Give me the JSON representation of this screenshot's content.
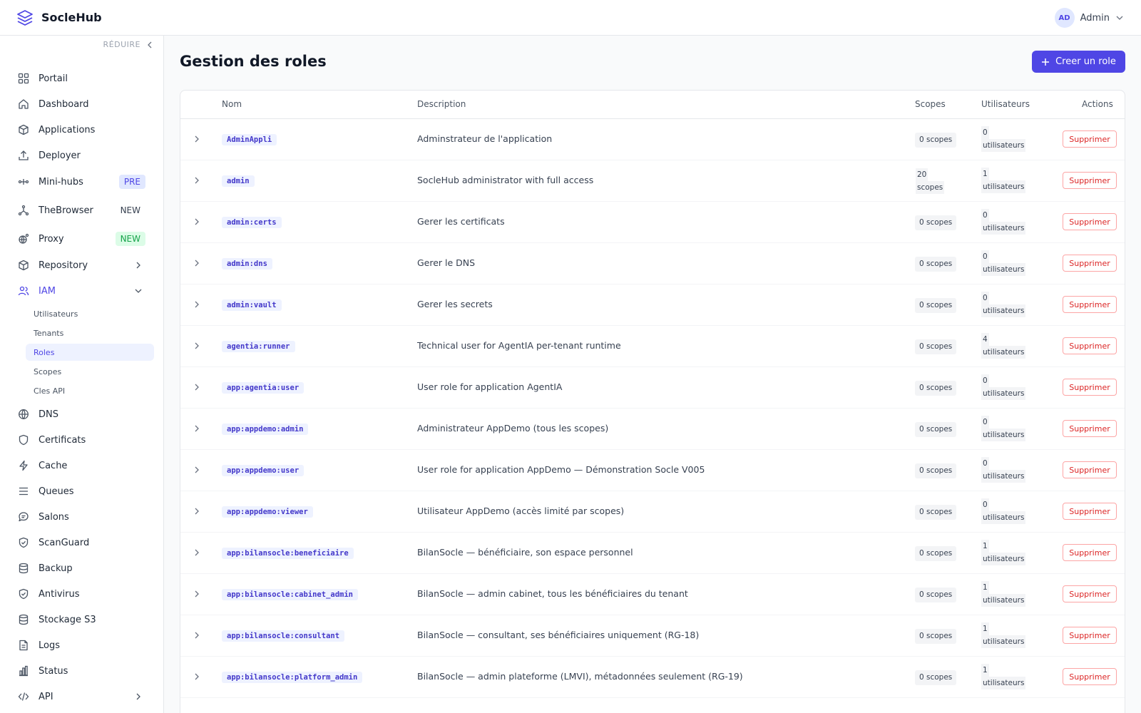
{
  "app": {
    "name": "SocleHub"
  },
  "user": {
    "initials": "AD",
    "name": "Admin"
  },
  "sidebar": {
    "collapse_label": "RÉDUIRE",
    "items": [
      {
        "label": "Portail",
        "icon": "grid-icon"
      },
      {
        "label": "Dashboard",
        "icon": "home-icon"
      },
      {
        "label": "Applications",
        "icon": "box-icon"
      },
      {
        "label": "Deployer",
        "icon": "upload-icon"
      },
      {
        "label": "Mini-hubs",
        "icon": "hub-icon",
        "badge": "PRE"
      },
      {
        "label": "TheBrowser",
        "icon": "network-icon",
        "badge": "NEW"
      },
      {
        "label": "Proxy",
        "icon": "globe-gear-icon",
        "badge": "NEW"
      },
      {
        "label": "Repository",
        "icon": "package-icon"
      },
      {
        "label": "IAM",
        "icon": "users-icon"
      },
      {
        "label": "DNS",
        "icon": "globe-icon"
      },
      {
        "label": "Certificats",
        "icon": "shield-icon"
      },
      {
        "label": "Cache",
        "icon": "bolt-icon"
      },
      {
        "label": "Queues",
        "icon": "list-icon"
      },
      {
        "label": "Salons",
        "icon": "chat-icon"
      },
      {
        "label": "ScanGuard",
        "icon": "shield-check-icon"
      },
      {
        "label": "Backup",
        "icon": "database-icon"
      },
      {
        "label": "Antivirus",
        "icon": "shield-check-icon"
      },
      {
        "label": "Stockage S3",
        "icon": "database-icon"
      },
      {
        "label": "Logs",
        "icon": "file-icon"
      },
      {
        "label": "Status",
        "icon": "bar-chart-icon"
      },
      {
        "label": "API",
        "icon": "code-icon"
      }
    ],
    "iam_sub": [
      "Utilisateurs",
      "Tenants",
      "Roles",
      "Scopes",
      "Cles API"
    ],
    "active_sub": "Roles"
  },
  "page": {
    "title": "Gestion des roles",
    "create_label": "Creer un role"
  },
  "table": {
    "headers": {
      "name": "Nom",
      "description": "Description",
      "scopes": "Scopes",
      "users": "Utilisateurs",
      "actions": "Actions"
    },
    "delete_label": "Supprimer",
    "rows": [
      {
        "name": "AdminAppli",
        "description": "Adminstrateur de l'application",
        "scopes": "0 scopes",
        "users_count": "0",
        "users_unit": "utilisateurs"
      },
      {
        "name": "admin",
        "description": "SocleHub administrator with full access",
        "scopes_count": "20",
        "scopes_unit": "scopes",
        "users_count": "1",
        "users_unit": "utilisateurs"
      },
      {
        "name": "admin:certs",
        "description": "Gerer les certificats",
        "scopes": "0 scopes",
        "users_count": "0",
        "users_unit": "utilisateurs"
      },
      {
        "name": "admin:dns",
        "description": "Gerer le DNS",
        "scopes": "0 scopes",
        "users_count": "0",
        "users_unit": "utilisateurs"
      },
      {
        "name": "admin:vault",
        "description": "Gerer les secrets",
        "scopes": "0 scopes",
        "users_count": "0",
        "users_unit": "utilisateurs"
      },
      {
        "name": "agentia:runner",
        "description": "Technical user for AgentIA per-tenant runtime",
        "scopes": "0 scopes",
        "users_count": "4",
        "users_unit": "utilisateurs"
      },
      {
        "name": "app:agentia:user",
        "description": "User role for application AgentIA",
        "scopes": "0 scopes",
        "users_count": "0",
        "users_unit": "utilisateurs"
      },
      {
        "name": "app:appdemo:admin",
        "description": "Administrateur AppDemo (tous les scopes)",
        "scopes": "0 scopes",
        "users_count": "0",
        "users_unit": "utilisateurs"
      },
      {
        "name": "app:appdemo:user",
        "description": "User role for application AppDemo — Démonstration Socle V005",
        "scopes": "0 scopes",
        "users_count": "0",
        "users_unit": "utilisateurs"
      },
      {
        "name": "app:appdemo:viewer",
        "description": "Utilisateur AppDemo (accès limité par scopes)",
        "scopes": "0 scopes",
        "users_count": "0",
        "users_unit": "utilisateurs"
      },
      {
        "name": "app:bilansocle:beneficiaire",
        "description": "BilanSocle — bénéficiaire, son espace personnel",
        "scopes": "0 scopes",
        "users_count": "1",
        "users_unit": "utilisateurs"
      },
      {
        "name": "app:bilansocle:cabinet_admin",
        "description": "BilanSocle — admin cabinet, tous les bénéficiaires du tenant",
        "scopes": "0 scopes",
        "users_count": "1",
        "users_unit": "utilisateurs"
      },
      {
        "name": "app:bilansocle:consultant",
        "description": "BilanSocle — consultant, ses bénéficiaires uniquement (RG-18)",
        "scopes": "0 scopes",
        "users_count": "1",
        "users_unit": "utilisateurs"
      },
      {
        "name": "app:bilansocle:platform_admin",
        "description": "BilanSocle — admin plateforme (LMVI), métadonnées seulement (RG-19)",
        "scopes": "0 scopes",
        "users_count": "1",
        "users_unit": "utilisateurs"
      }
    ]
  }
}
